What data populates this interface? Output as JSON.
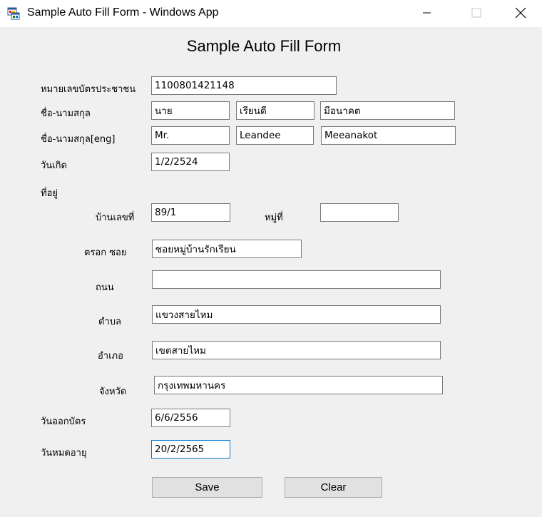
{
  "window": {
    "title": "Sample Auto Fill Form - Windows App",
    "minimize_icon": "minimize-icon",
    "maximize_icon": "maximize-icon",
    "close_icon": "close-icon"
  },
  "form": {
    "title": "Sample Auto Fill Form",
    "labels": {
      "id_number": "หมายเลขบัตรประชาชน",
      "name_th": "ชื่อ-นามสกุล",
      "name_en": "ชื่อ-นามสกุล[eng]",
      "birthdate": "วันเกิด",
      "address": "ที่อยู่",
      "house_no": "บ้านเลขที่",
      "moo": "หมู่ที่",
      "soi": "ตรอก ซอย",
      "road": "ถนน",
      "subdistrict": "ตำบล",
      "district": "อำเภอ",
      "province": "จังหวัด",
      "issue_date": "วันออกบัตร",
      "expiry_date": "วันหมดอายุ"
    },
    "values": {
      "id_number": "1100801421148",
      "prefix_th": "นาย",
      "first_th": "เรียนดี",
      "last_th": "มีอนาคต",
      "prefix_en": "Mr.",
      "first_en": "Leandee",
      "last_en": "Meeanakot",
      "birthdate": "1/2/2524",
      "house_no": "89/1",
      "moo": "",
      "soi": "ซอยหมู่บ้านรักเรียน",
      "road": "",
      "subdistrict": "แขวงสายไหม",
      "district": "เขตสายไหม",
      "province": "กรุงเทพมหานคร",
      "issue_date": "6/6/2556",
      "expiry_date": "20/2/2565"
    },
    "buttons": {
      "save": "Save",
      "clear": "Clear"
    }
  },
  "colors": {
    "background": "#f0f0f0",
    "titlebar": "#ffffff",
    "focus_border": "#0078d7",
    "button_face": "#e1e1e1"
  }
}
